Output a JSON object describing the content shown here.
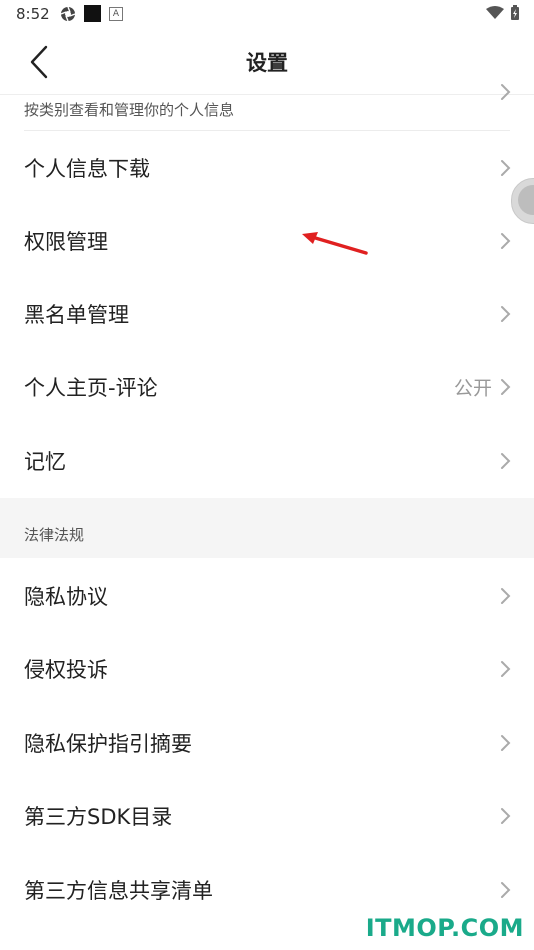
{
  "status_bar": {
    "time": "8:52",
    "left_icons": [
      "aperture-icon",
      "black-square-icon",
      "a-badge-icon"
    ],
    "right_icons": [
      "wifi-icon",
      "battery-charging-icon"
    ]
  },
  "header": {
    "title": "设置",
    "back_icon": "chevron-left-icon"
  },
  "partial_item": {
    "text": "按类别查看和管理你的个人信息"
  },
  "privacy_items": [
    {
      "label": "个人信息下载",
      "value": ""
    },
    {
      "label": "权限管理",
      "value": ""
    },
    {
      "label": "黑名单管理",
      "value": ""
    },
    {
      "label": "个人主页-评论",
      "value": "公开"
    },
    {
      "label": "记忆",
      "value": ""
    }
  ],
  "legal_section": {
    "title": "法律法规",
    "items": [
      {
        "label": "隐私协议"
      },
      {
        "label": "侵权投诉"
      },
      {
        "label": "隐私保护指引摘要"
      },
      {
        "label": "第三方SDK目录"
      },
      {
        "label": "第三方信息共享清单"
      }
    ]
  },
  "watermark": "ITMOP.COM",
  "colors": {
    "accent_watermark": "#1aaa8a",
    "annotation_arrow": "#e02020",
    "section_bg": "#f5f5f5"
  }
}
